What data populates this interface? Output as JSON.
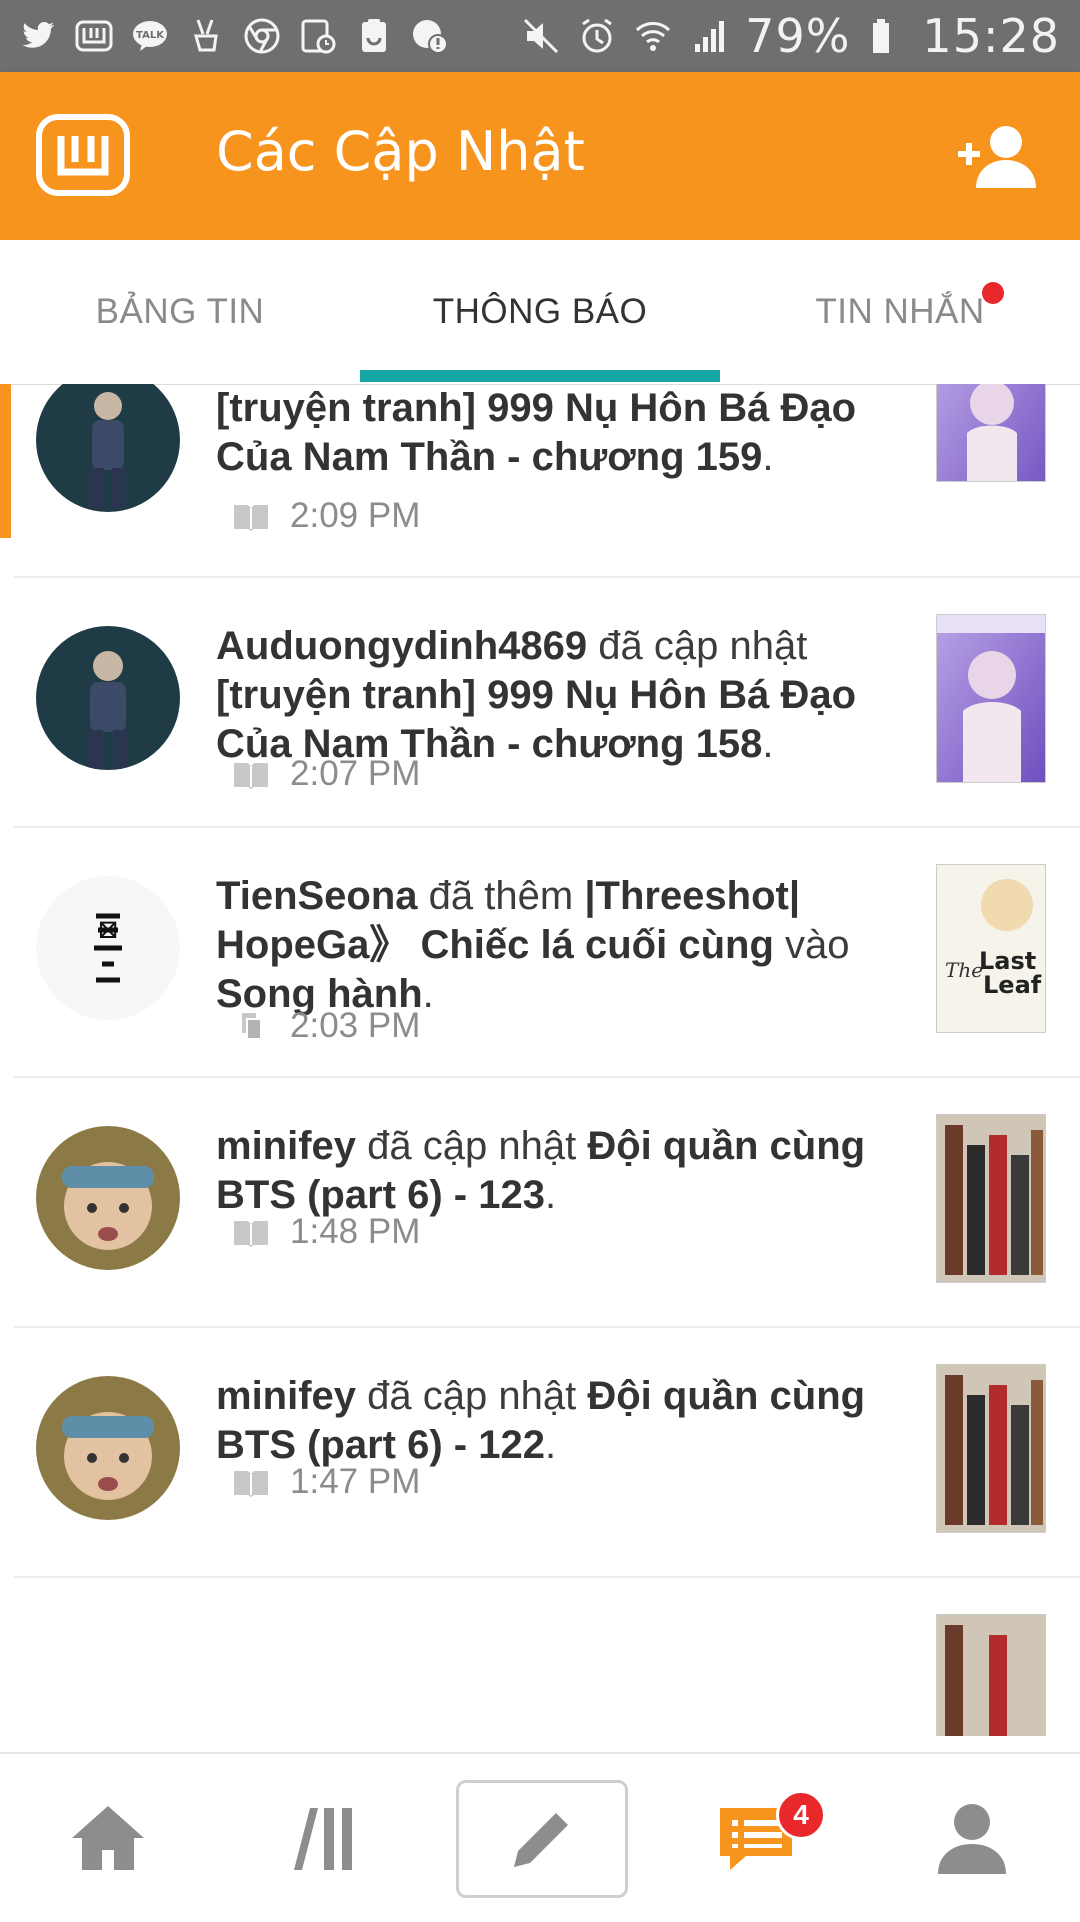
{
  "status_bar": {
    "battery": "79%",
    "time": "15:28",
    "left_icons": [
      "twitter-icon",
      "wattpad-icon",
      "kakaotalk-icon",
      "victory-icon",
      "chrome-icon",
      "calendar-icon",
      "clipboard-icon",
      "alert-icon"
    ],
    "right_icons": [
      "mute-icon",
      "alarm-icon",
      "wifi-icon",
      "signal-icon",
      "battery-icon"
    ]
  },
  "app_bar": {
    "title": "Các Cập Nhật",
    "logo": "wattpad-logo",
    "action_icon": "add-user-icon"
  },
  "tabs": [
    {
      "label": "BẢNG TIN",
      "active": false
    },
    {
      "label": "THÔNG BÁO",
      "active": true
    },
    {
      "label": "TIN NHẮN",
      "active": false,
      "has_dot": true
    }
  ],
  "notifications": [
    {
      "actor": "",
      "action": "",
      "object": "[truyện tranh] 999 Nụ Hôn Bá Đạo Của Nam Thần - chương 159",
      "suffix": ".",
      "time": "2:09 PM",
      "icon": "book-icon",
      "unread": true
    },
    {
      "actor": "Auduongydinh4869",
      "action": " đã cập nhật ",
      "object": "[truyện tranh] 999 Nụ Hôn Bá Đạo Của Nam Thần - chương 158",
      "suffix": ".",
      "time": "2:07 PM",
      "icon": "book-icon",
      "unread": false
    },
    {
      "actor": "TienSeona",
      "action": " đã thêm ",
      "object": "|Threeshot| HopeGa》 Chiếc lá cuối cùng",
      "middle": " vào ",
      "object2": "Song hành",
      "suffix": ".",
      "time": "2:03 PM",
      "icon": "reading-list-icon",
      "unread": false
    },
    {
      "actor": "minifey",
      "action": " đã cập nhật ",
      "object": "Đội quần cùng BTS (part 6) - 123",
      "suffix": ".",
      "time": "1:48 PM",
      "icon": "book-icon",
      "unread": false
    },
    {
      "actor": "minifey",
      "action": " đã cập nhật ",
      "object": "Đội quần cùng BTS (part 6) - 122",
      "suffix": ".",
      "time": "1:47 PM",
      "icon": "book-icon",
      "unread": false
    }
  ],
  "bottom_nav": {
    "items": [
      "home-icon",
      "library-icon",
      "compose-icon",
      "notifications-icon",
      "profile-icon"
    ],
    "notification_badge": "4"
  },
  "colors": {
    "brand_orange": "#f7941d",
    "tab_indicator": "#15a6a6",
    "badge_red": "#e8282a"
  }
}
